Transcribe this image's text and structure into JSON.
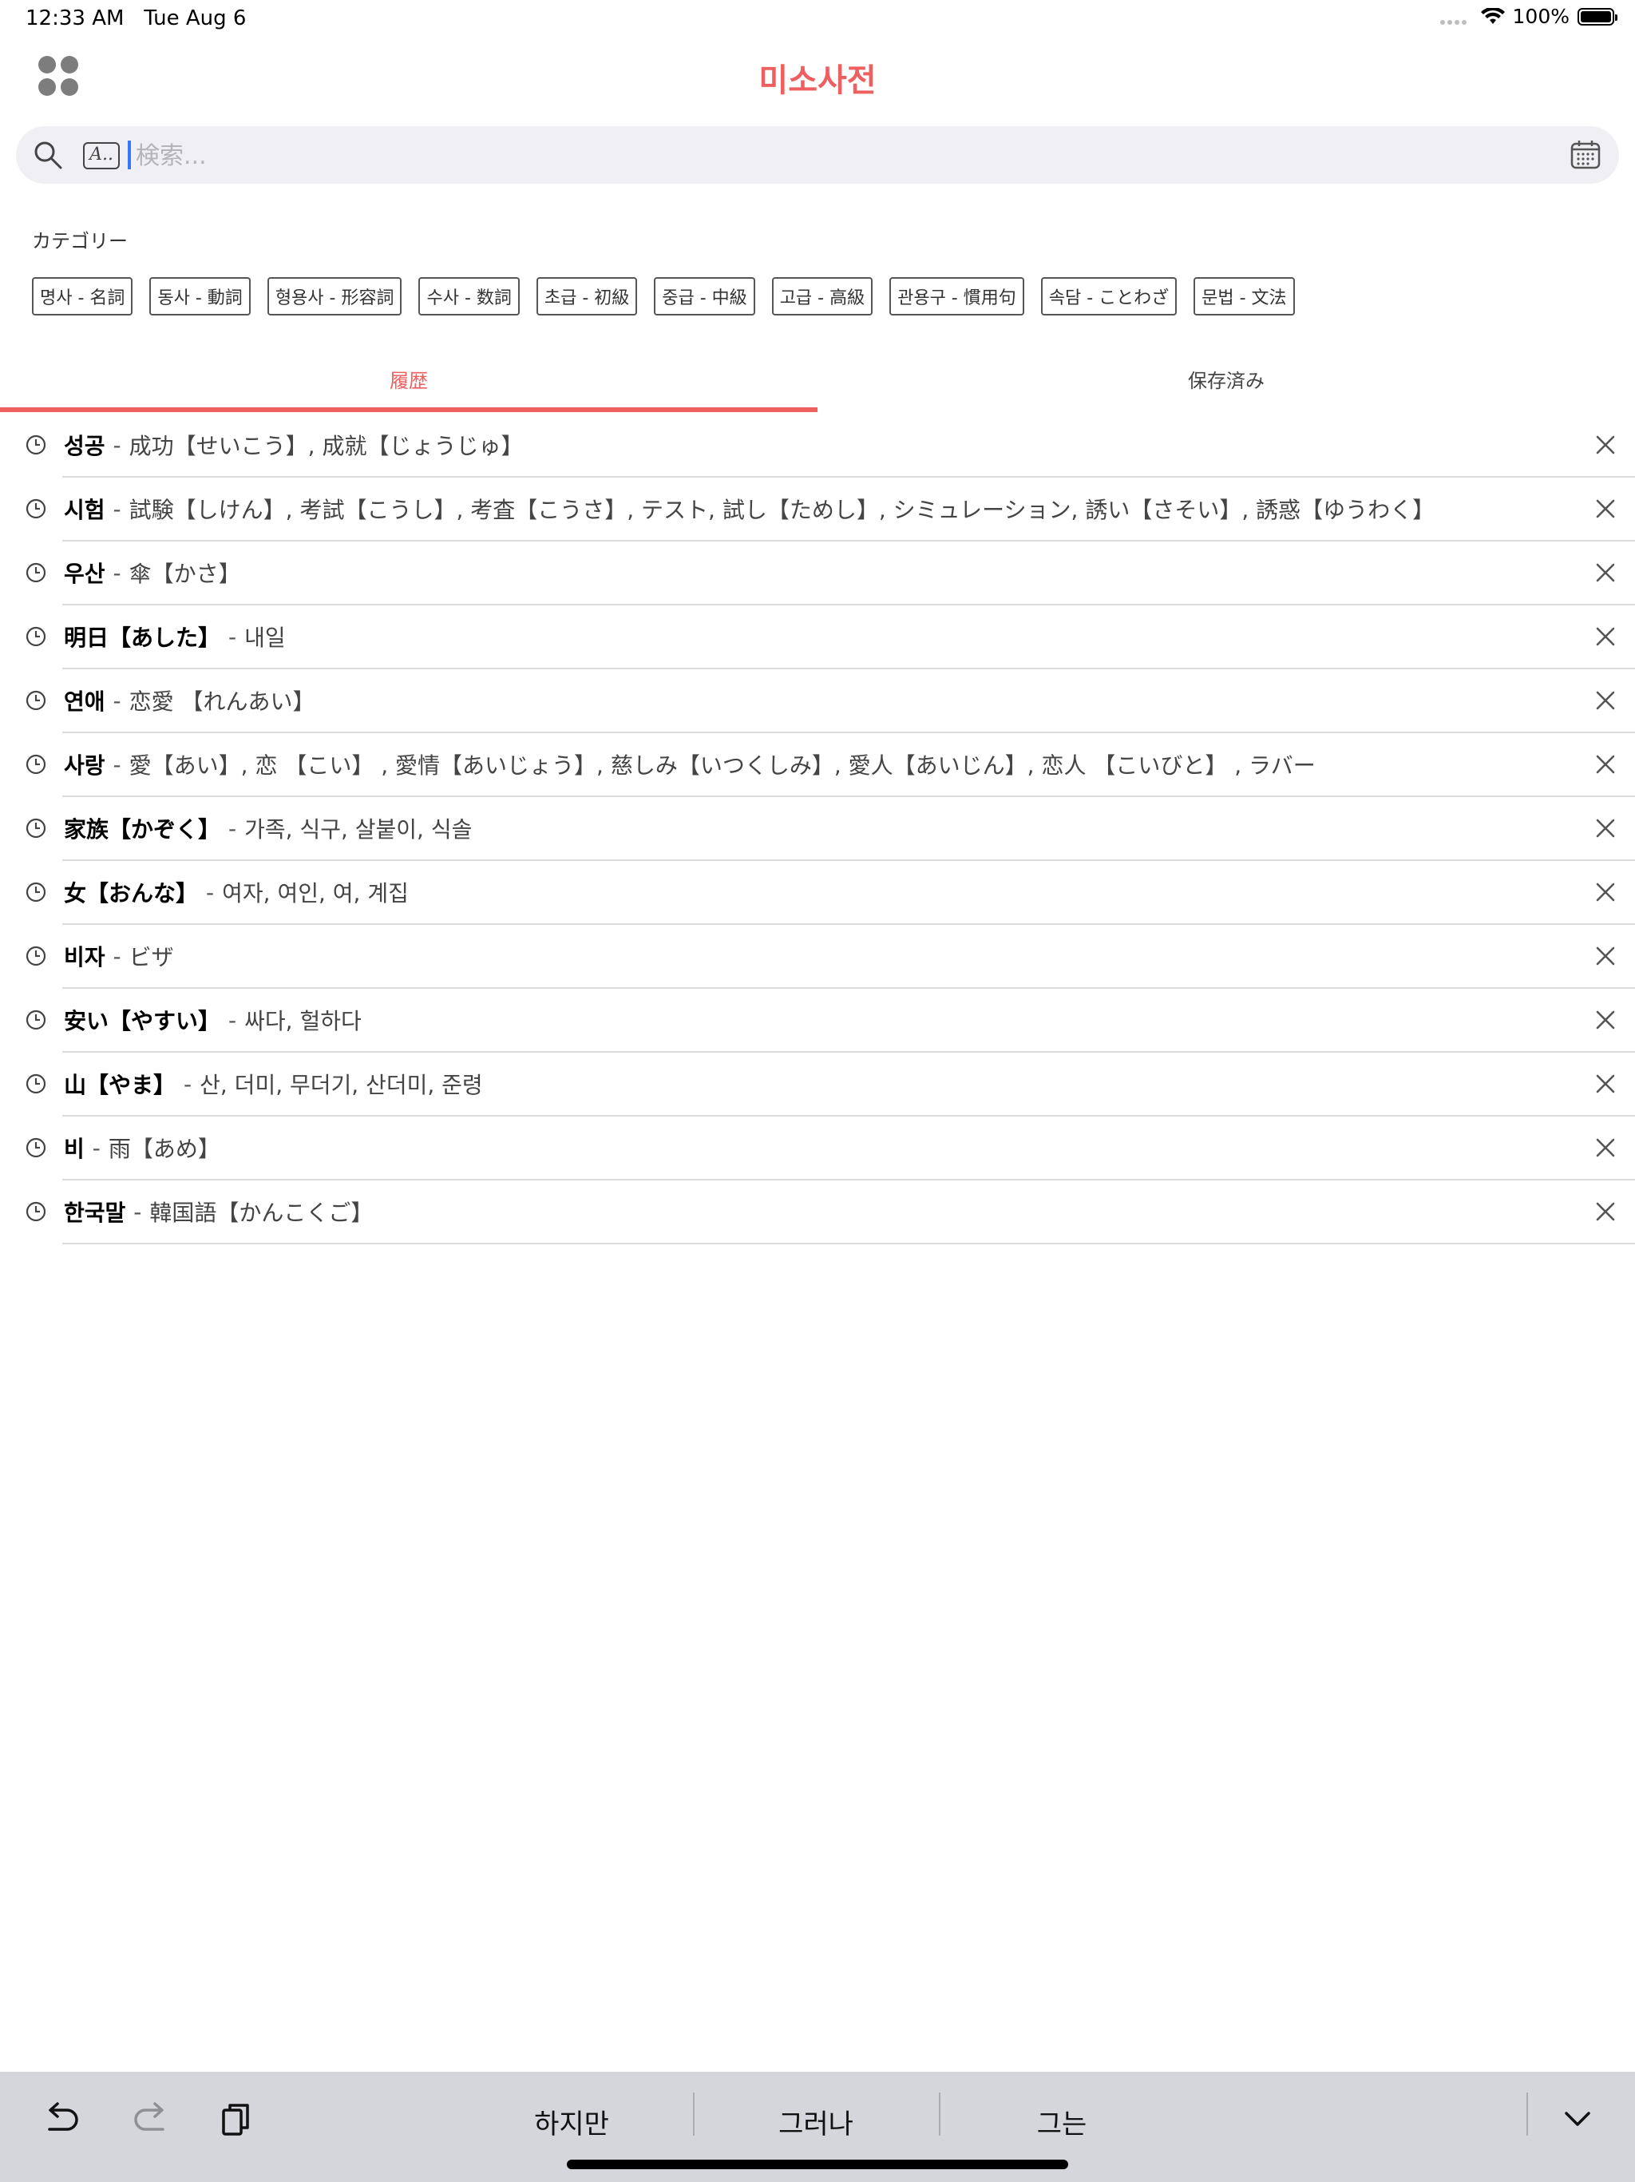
{
  "status_bar": {
    "time": "12:33 AM",
    "date": "Tue Aug 6",
    "battery_percent": "100%"
  },
  "header": {
    "title": "미소사전",
    "menu_icon": "grid-dots-icon"
  },
  "search": {
    "placeholder": "検索...",
    "value": "",
    "handwriting_label": "A..",
    "icons": [
      "search-icon",
      "handwriting-icon",
      "calendar-icon"
    ]
  },
  "categories": {
    "label": "カテゴリー",
    "items": [
      {
        "label": "명사 - 名詞"
      },
      {
        "label": "동사 - 動詞"
      },
      {
        "label": "형용사 - 形容詞"
      },
      {
        "label": "수사 - 数詞"
      },
      {
        "label": "초급 - 初級"
      },
      {
        "label": "중급 - 中級"
      },
      {
        "label": "고급 - 高級"
      },
      {
        "label": "관용구 - 慣用句"
      },
      {
        "label": "속담 - ことわざ"
      },
      {
        "label": "문법 - 文法"
      }
    ]
  },
  "tabs": {
    "history": "履歴",
    "saved": "保存済み",
    "active": "history"
  },
  "history": [
    {
      "word": "성공",
      "sep": "-",
      "meaning": "成功【せいこう】, 成就【じょうじゅ】"
    },
    {
      "word": "시험",
      "sep": "-",
      "meaning": "試験【しけん】, 考試【こうし】, 考査【こうさ】, テスト, 試し【ためし】, シミュレーション, 誘い【さそい】, 誘惑【ゆうわく】"
    },
    {
      "word": "우산",
      "sep": "-",
      "meaning": "傘【かさ】"
    },
    {
      "word": "明日【あした】",
      "sep": "-",
      "meaning": "내일"
    },
    {
      "word": "연애",
      "sep": "-",
      "meaning": "恋愛 【れんあい】"
    },
    {
      "word": "사랑",
      "sep": "-",
      "meaning": "愛【あい】, 恋 【こい】 , 愛情【あいじょう】, 慈しみ【いつくしみ】, 愛人【あいじん】, 恋人 【こいびと】 , ラバー"
    },
    {
      "word": "家族【かぞく】",
      "sep": "-",
      "meaning": "가족, 식구, 살붙이, 식솔"
    },
    {
      "word": "女【おんな】",
      "sep": "-",
      "meaning": "여자, 여인, 여, 계집"
    },
    {
      "word": "비자",
      "sep": "-",
      "meaning": "ビザ"
    },
    {
      "word": "安い【やすい】",
      "sep": "-",
      "meaning": "싸다, 헐하다"
    },
    {
      "word": "山【やま】",
      "sep": "-",
      "meaning": "산, 더미, 무더기, 산더미, 준령"
    },
    {
      "word": "비",
      "sep": "-",
      "meaning": "雨【あめ】"
    },
    {
      "word": "한국말",
      "sep": "-",
      "meaning": "韓国語【かんこくご】"
    }
  ],
  "keyboard_bar": {
    "suggestions": [
      "하지만",
      "그러나",
      "그는"
    ],
    "icons": [
      "undo-icon",
      "redo-icon",
      "paste-icon",
      "chevron-down-icon"
    ]
  },
  "colors": {
    "accent": "#ee5f5f",
    "search_bg": "#f0f0f4",
    "keyboard_bar_bg": "#d4d6dc"
  }
}
